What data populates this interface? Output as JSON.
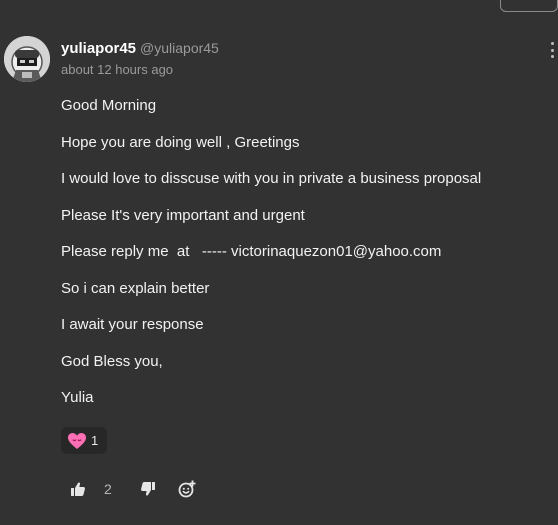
{
  "comment": {
    "author": {
      "username": "yuliapor45",
      "handle": "@yuliapor45",
      "avatar_icon": "robot-avatar-icon"
    },
    "timestamp": "about 12 hours ago",
    "lines": [
      "Good Morning",
      "Hope you are doing well , Greetings",
      "I would love to disscuse with you in private a business proposal",
      "Please It's very important and urgent",
      "Please reply me  at   ----- victorinaquezon01@yahoo.com",
      "So i can explain better",
      "I await your response",
      "God Bless you,",
      "Yulia"
    ],
    "reaction": {
      "icon": "heart-emoji-icon",
      "count": "1"
    },
    "actions": {
      "like_icon": "thumbs-up-icon",
      "like_count": "2",
      "dislike_icon": "thumbs-down-icon",
      "add_reaction_icon": "add-emoji-icon"
    },
    "menu_icon": "kebab-menu-icon"
  },
  "colors": {
    "background": "#323232",
    "reaction_bg": "#272727",
    "heart": "#ff6fb3"
  }
}
